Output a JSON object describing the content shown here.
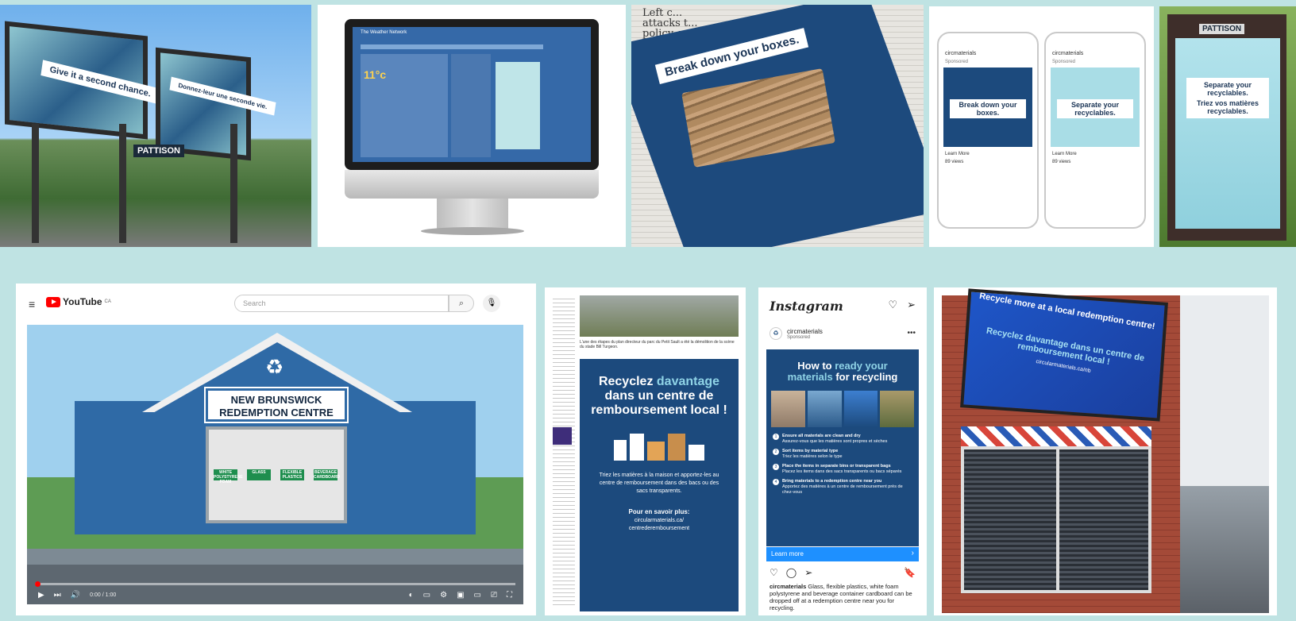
{
  "billboard": {
    "left_text": "Give it a second chance.",
    "right_text": "Donnez-leur une seconde vie.",
    "brand": "PATTISON"
  },
  "monitor": {
    "site_name": "The Weather Network",
    "temperature": "11°c"
  },
  "newspaper": {
    "top_words": "Left c... attacks t... policy, wa...",
    "headline": "Break down your boxes."
  },
  "phones": {
    "account": "circmaterials",
    "sponsored": "Sponsored",
    "left_caption": "Break down your boxes.",
    "right_caption": "Separate your recyclables.",
    "learn_more": "Learn More",
    "views": "89 views"
  },
  "shelter": {
    "brand": "PATTISON",
    "line1": "Separate your recyclables.",
    "line2": "Triez vos matières recyclables."
  },
  "youtube": {
    "brand": "YouTube",
    "region": "CA",
    "search_placeholder": "Search",
    "sign_line1": "NEW BRUNSWICK",
    "sign_line2": "REDEMPTION CENTRE",
    "bins": [
      "WHITE POLYSTYRENE FOAM",
      "GLASS",
      "FLEXIBLE PLASTICS",
      "BEVERAGE CARDBOARD"
    ],
    "time": "0:00 / 1:00"
  },
  "french_ad": {
    "caption": "L'une des étapes du plan directeur du parc du Petit Sault a été la démolition de la scène du stade Bill Turgeon.",
    "headline_1": "Recyclez",
    "headline_hl": "davantage",
    "headline_2": "dans un centre de remboursement local !",
    "body": "Triez les matières à la maison et apportez-les au centre de remboursement dans des bacs ou des sacs transparents.",
    "more": "Pour en savoir plus:",
    "url_1": "circularmaterials.ca/",
    "url_2": "centrederemboursement"
  },
  "instagram": {
    "brand": "Instagram",
    "account": "circmaterials",
    "sponsored": "Sponsored",
    "headline_1": "How to",
    "headline_hl": "ready your",
    "headline_2": "materials",
    "headline_3": "for recycling",
    "steps": [
      {
        "n": "1",
        "en": "Ensure all materials are clean and dry",
        "fr": "Assurez-vous que les matières sont propres et sèches"
      },
      {
        "n": "2",
        "en": "Sort items by material type",
        "fr": "Triez les matières selon le type"
      },
      {
        "n": "3",
        "en": "Place the items in separate bins or transparent bags",
        "fr": "Placez les items dans des sacs transparents ou bacs séparés"
      },
      {
        "n": "4",
        "en": "Bring materials to a redemption centre near you",
        "fr": "Apportez des matières à un centre de remboursement près de chez-vous"
      }
    ],
    "learn_more": "Learn more",
    "caption_account": "circmaterials",
    "caption_text": "Glass, flexible plastics, white foam polystyrene and beverage container cardboard can be dropped off at a redemption centre near you for recycling."
  },
  "storefront": {
    "line1": "Recycle more at a local redemption centre!",
    "line2": "Recyclez davantage dans un centre de remboursement local !",
    "url": "circularmaterials.ca/nb"
  }
}
